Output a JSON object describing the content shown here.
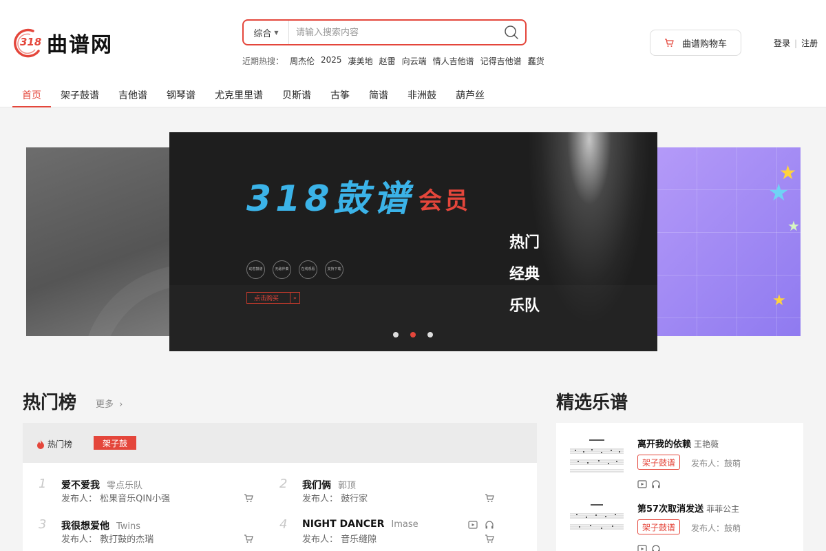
{
  "header": {
    "logo_text": "曲谱网",
    "logo_number": "318",
    "search": {
      "category": "综合",
      "placeholder": "请输入搜索内容"
    },
    "hot_search_label": "近期热搜：",
    "hot_keywords": [
      "周杰伦",
      "2025",
      "凄美地",
      "赵雷",
      "向云端",
      "情人吉他谱",
      "记得吉他谱",
      "蠢货"
    ],
    "cart_label": "曲谱购物车",
    "login": "登录",
    "register": "注册"
  },
  "nav": [
    "首页",
    "架子鼓谱",
    "吉他谱",
    "钢琴谱",
    "尤克里里谱",
    "贝斯谱",
    "古筝",
    "简谱",
    "非洲鼓",
    "葫芦丝"
  ],
  "banner": {
    "title": "318鼓谱",
    "subtitle": "会员",
    "words": [
      "热门",
      "经典",
      "乐队"
    ],
    "features": [
      "动态鼓谱",
      "无敌伴奏",
      "在线观看",
      "支持下载"
    ],
    "buy_button": "点击购买",
    "active_slide": 1
  },
  "hot": {
    "title": "热门榜",
    "more": "更多",
    "panel_label": "热门榜",
    "category_tab": "架子鼓",
    "publisher_prefix": "发布人：",
    "items": [
      {
        "rank": "1",
        "song": "爱不爱我",
        "artist": "零点乐队",
        "publisher": "松果音乐QIN小强"
      },
      {
        "rank": "2",
        "song": "我们俩",
        "artist": "郭顶",
        "publisher": "鼓行家"
      },
      {
        "rank": "3",
        "song": "我很想爱他",
        "artist": "Twins",
        "publisher": "教打鼓的杰瑞"
      },
      {
        "rank": "4",
        "song": "NIGHT DANCER",
        "artist": "Imase",
        "publisher": "音乐缝隙"
      }
    ]
  },
  "featured": {
    "title": "精选乐谱",
    "publisher_prefix": "发布人：",
    "items": [
      {
        "song": "离开我的依赖",
        "artist": "王艳薇",
        "tag": "架子鼓谱",
        "publisher": "鼓萌"
      },
      {
        "song": "第57次取消发送",
        "artist": "菲菲公主",
        "tag": "架子鼓谱",
        "publisher": "鼓萌"
      }
    ]
  },
  "colors": {
    "accent": "#e4463b",
    "banner_blue": "#3bb3e8"
  }
}
